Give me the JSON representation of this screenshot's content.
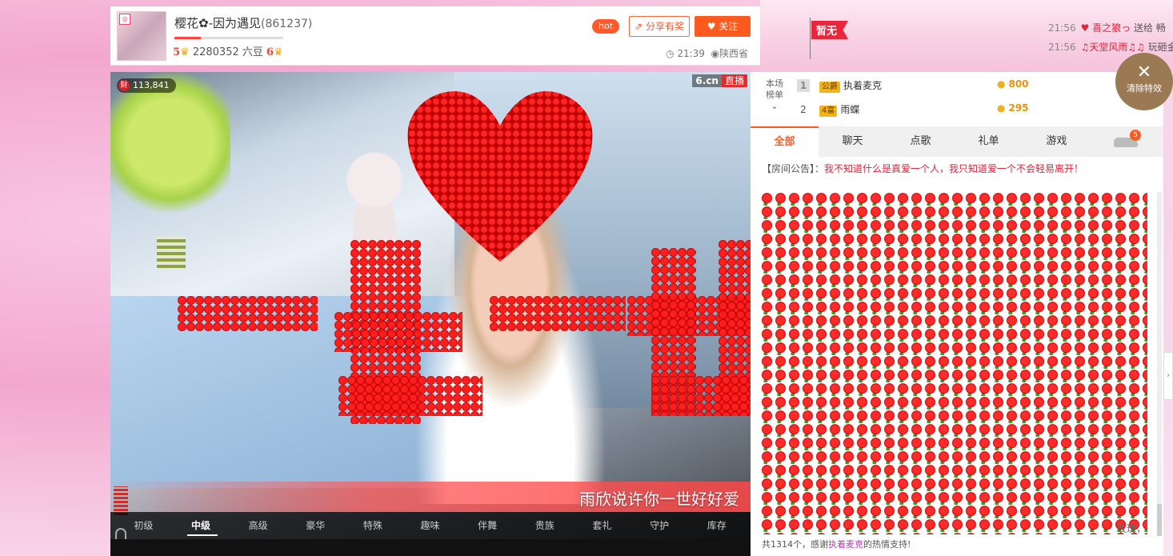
{
  "header": {
    "anchor_name": "樱花✿-因为遇见",
    "room_id": "(861237)",
    "level_left": "5",
    "beans": "2280352 六豆",
    "level_right": "6",
    "hot_label": "hot",
    "share_label": "分享有奖",
    "follow_label": "关注",
    "time": "21:39",
    "location": "陕西省"
  },
  "banner": {
    "flag_label": "暂无",
    "notices": [
      {
        "time": "21:56",
        "user": "♥ 喜之狼っ",
        "action": "送给 畅"
      },
      {
        "time": "21:56",
        "user": "♫天堂风雨♫♫",
        "action": "玩砸金"
      }
    ]
  },
  "video": {
    "viewer_icon": "财",
    "viewer_count": "113,841",
    "brand": "6.cn",
    "live_label": "直播",
    "gift_banner_text": "雨欣说许你一世好好爱",
    "gift_tabs": [
      "初级",
      "中级",
      "高级",
      "豪华",
      "特殊",
      "趣味",
      "伴舞",
      "贵族",
      "套礼",
      "守护",
      "库存"
    ],
    "active_gift_tab": "中级"
  },
  "rank": {
    "label_line1": "本场",
    "label_line2": "榜单",
    "rows": [
      {
        "num": "1",
        "badge": "公爵",
        "name": "执着麦克",
        "coins": "800"
      },
      {
        "num": "2",
        "badge": "4富",
        "name": "雨蝶",
        "coins": "295"
      }
    ]
  },
  "chat": {
    "tabs": [
      "全部",
      "聊天",
      "点歌",
      "礼单",
      "游戏"
    ],
    "active_tab": "全部",
    "car_badge": "5",
    "announce_label": "【房间公告】：",
    "announce_text": "我不知道什么是真爱一个人，我只知道爱一个不会轻易离开！",
    "rose_tail": "玫瑰，",
    "footer_prefix": "共1314个，感谢",
    "footer_name": "执着麦克",
    "footer_suffix": "的热情支持!"
  },
  "clear_fx_label": "清除特效",
  "colors": {
    "accent": "#ff5a1e",
    "red": "#e0253c",
    "gold": "#e7920c"
  }
}
